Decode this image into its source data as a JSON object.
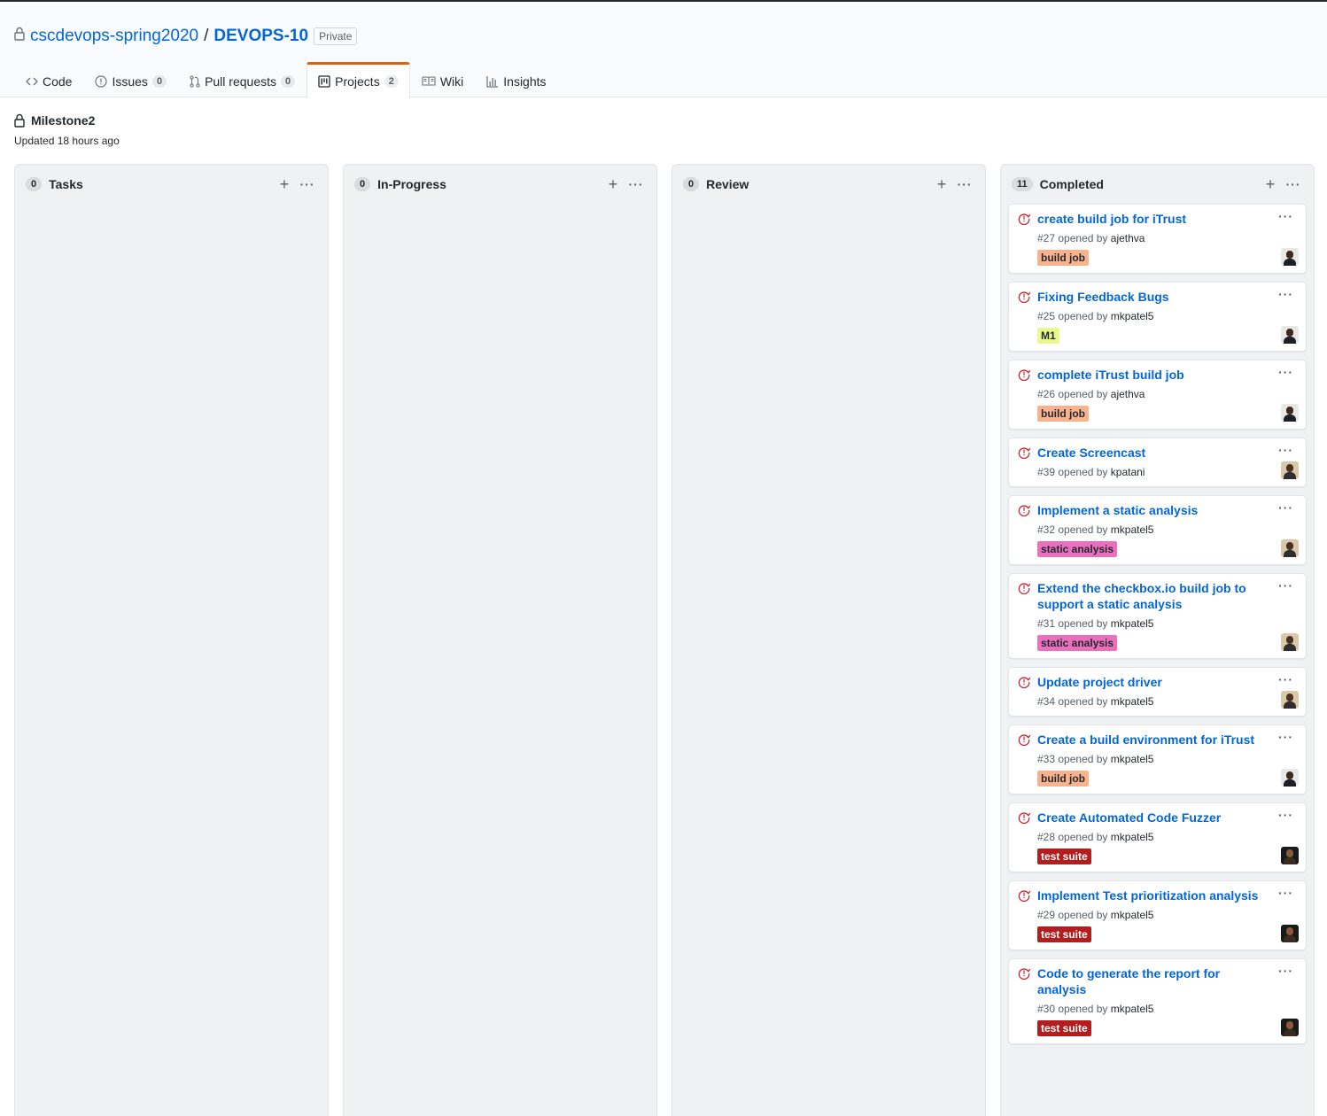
{
  "repo": {
    "owner": "cscdevops-spring2020",
    "separator": "/",
    "name": "DEVOPS-10",
    "visibility": "Private"
  },
  "tabs": [
    {
      "label": "Code",
      "icon": "code-icon"
    },
    {
      "label": "Issues",
      "count": "0",
      "icon": "issue-icon"
    },
    {
      "label": "Pull requests",
      "count": "0",
      "icon": "pull-request-icon"
    },
    {
      "label": "Projects",
      "count": "2",
      "icon": "project-icon",
      "selected": true
    },
    {
      "label": "Wiki",
      "icon": "book-icon"
    },
    {
      "label": "Insights",
      "icon": "graph-icon"
    }
  ],
  "project": {
    "title": "Milestone2",
    "updated": "Updated 18 hours ago"
  },
  "columns": [
    {
      "name": "Tasks",
      "count": "0",
      "cards": []
    },
    {
      "name": "In-Progress",
      "count": "0",
      "cards": []
    },
    {
      "name": "Review",
      "count": "0",
      "cards": []
    },
    {
      "name": "Completed",
      "count": "11",
      "cards": [
        {
          "title": "create build job for iTrust",
          "number": "#27",
          "opened_by": "opened by",
          "user": "ajethva",
          "label": "build job",
          "label_bg": "#f9b28e",
          "label_fg": "#24292e",
          "avatar": "dark"
        },
        {
          "title": "Fixing Feedback Bugs",
          "number": "#25",
          "opened_by": "opened by",
          "user": "mkpatel5",
          "label": "M1",
          "label_bg": "#eaf98e",
          "label_fg": "#24292e",
          "avatar": "dark"
        },
        {
          "title": "complete iTrust build job",
          "number": "#26",
          "opened_by": "opened by",
          "user": "ajethva",
          "label": "build job",
          "label_bg": "#f9b28e",
          "label_fg": "#24292e",
          "avatar": "dark"
        },
        {
          "title": "Create Screencast",
          "number": "#39",
          "opened_by": "opened by",
          "user": "kpatani",
          "label": "",
          "label_bg": "",
          "label_fg": "",
          "avatar": "tan"
        },
        {
          "title": "Implement a static analysis",
          "number": "#32",
          "opened_by": "opened by",
          "user": "mkpatel5",
          "label": "static analysis",
          "label_bg": "#ea6fbe",
          "label_fg": "#24292e",
          "avatar": "tan"
        },
        {
          "title": "Extend the checkbox.io build job to support a static analysis",
          "number": "#31",
          "opened_by": "opened by",
          "user": "mkpatel5",
          "label": "static analysis",
          "label_bg": "#ea6fbe",
          "label_fg": "#24292e",
          "avatar": "tan"
        },
        {
          "title": "Update project driver",
          "number": "#34",
          "opened_by": "opened by",
          "user": "mkpatel5",
          "label": "",
          "label_bg": "",
          "label_fg": "",
          "avatar": "tan"
        },
        {
          "title": "Create a build environment for iTrust",
          "number": "#33",
          "opened_by": "opened by",
          "user": "mkpatel5",
          "label": "build job",
          "label_bg": "#f9b28e",
          "label_fg": "#24292e",
          "avatar": "dark"
        },
        {
          "title": "Create Automated Code Fuzzer",
          "number": "#28",
          "opened_by": "opened by",
          "user": "mkpatel5",
          "label": "test suite",
          "label_bg": "#b31d1d",
          "label_fg": "#ffffff",
          "avatar": "black"
        },
        {
          "title": "Implement Test prioritization analysis",
          "number": "#29",
          "opened_by": "opened by",
          "user": "mkpatel5",
          "label": "test suite",
          "label_bg": "#b31d1d",
          "label_fg": "#ffffff",
          "avatar": "black"
        },
        {
          "title": "Code to generate the report for analysis",
          "number": "#30",
          "opened_by": "opened by",
          "user": "mkpatel5",
          "label": "test suite",
          "label_bg": "#b31d1d",
          "label_fg": "#ffffff",
          "avatar": "black"
        }
      ]
    }
  ]
}
